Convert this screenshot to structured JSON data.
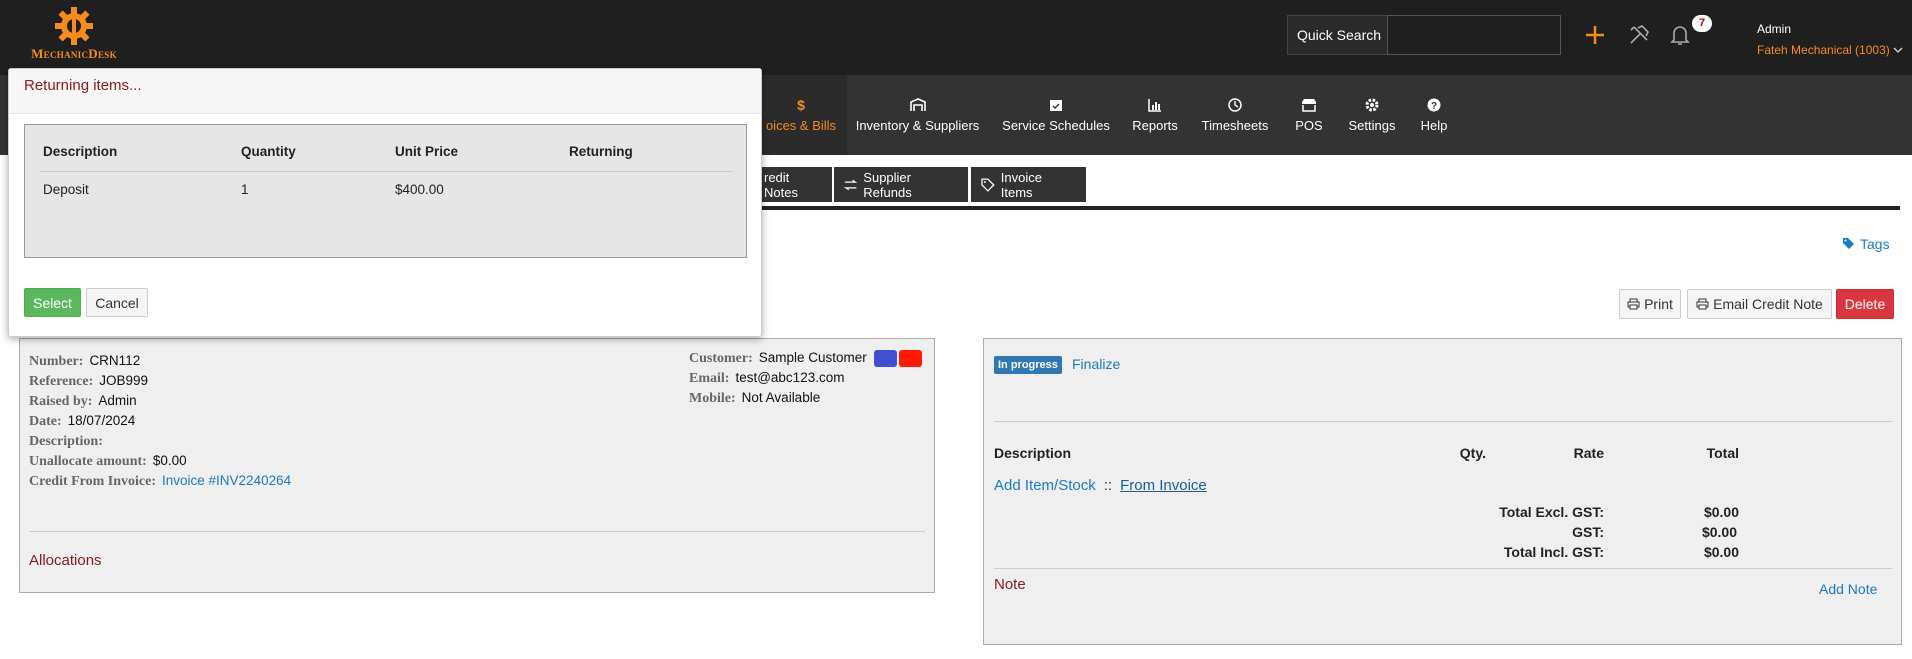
{
  "app": {
    "logo_text": "MechanicDesk",
    "brand_color": "#f58c1f"
  },
  "header": {
    "quick_search_label": "Quick Search",
    "quick_search_value": "",
    "notification_count": "7",
    "user_name": "Admin",
    "company": "Fateh Mechanical (1003)"
  },
  "nav": {
    "items": [
      {
        "label": "oices & Bills",
        "icon": "dollar-icon",
        "active": true
      },
      {
        "label": "Inventory & Suppliers",
        "icon": "warehouse-icon"
      },
      {
        "label": "Service Schedules",
        "icon": "calendar-check-icon"
      },
      {
        "label": "Reports",
        "icon": "bar-chart-icon"
      },
      {
        "label": "Timesheets",
        "icon": "clock-icon"
      },
      {
        "label": "POS",
        "icon": "store-icon"
      },
      {
        "label": "Settings",
        "icon": "gear-icon"
      },
      {
        "label": "Help",
        "icon": "question-icon"
      }
    ]
  },
  "subtabs": [
    {
      "label": "redit Notes"
    },
    {
      "label": "Supplier Refunds",
      "icon": "exchange-icon"
    },
    {
      "label": "Invoice Items",
      "icon": "tag-icon"
    }
  ],
  "tags_link": "Tags",
  "actions": {
    "print": "Print",
    "email": "Email Credit Note",
    "delete": "Delete"
  },
  "credit_note": {
    "fields": {
      "number_label": "Number:",
      "number": "CRN112",
      "reference_label": "Reference:",
      "reference": "JOB999",
      "raised_by_label": "Raised by:",
      "raised_by": "Admin",
      "date_label": "Date:",
      "date": "18/07/2024",
      "description_label": "Description:",
      "description": "",
      "unallocate_label": "Unallocate amount:",
      "unallocate": "$0.00",
      "credit_from_label": "Credit From Invoice:",
      "credit_from": "Invoice #INV2240264"
    },
    "customer": {
      "customer_label": "Customer:",
      "customer": "Sample Customer",
      "email_label": "Email:",
      "email": "test@abc123.com",
      "mobile_label": "Mobile:",
      "mobile": "Not Available",
      "swatch_colors": [
        "#3f4fd1",
        "#ff1a00"
      ]
    },
    "allocations_title": "Allocations"
  },
  "items_panel": {
    "status": "In progress",
    "status_color": "#2f78b4",
    "finalize": "Finalize",
    "columns": {
      "description": "Description",
      "qty": "Qty.",
      "rate": "Rate",
      "total": "Total"
    },
    "add_item": "Add Item/Stock",
    "separator": "::",
    "from_invoice": "From Invoice",
    "totals": [
      {
        "label": "Total Excl. GST:",
        "value": "$0.00"
      },
      {
        "label": "GST:",
        "value": "$0.00"
      },
      {
        "label": "Total Incl. GST:",
        "value": "$0.00"
      }
    ],
    "note_title": "Note",
    "add_note": "Add Note"
  },
  "modal": {
    "title": "Returning items...",
    "columns": {
      "description": "Description",
      "quantity": "Quantity",
      "unit_price": "Unit Price",
      "returning": "Returning"
    },
    "rows": [
      {
        "description": "Deposit",
        "quantity": "1",
        "unit_price": "$400.00",
        "returning": ""
      }
    ],
    "select_label": "Select",
    "cancel_label": "Cancel"
  }
}
